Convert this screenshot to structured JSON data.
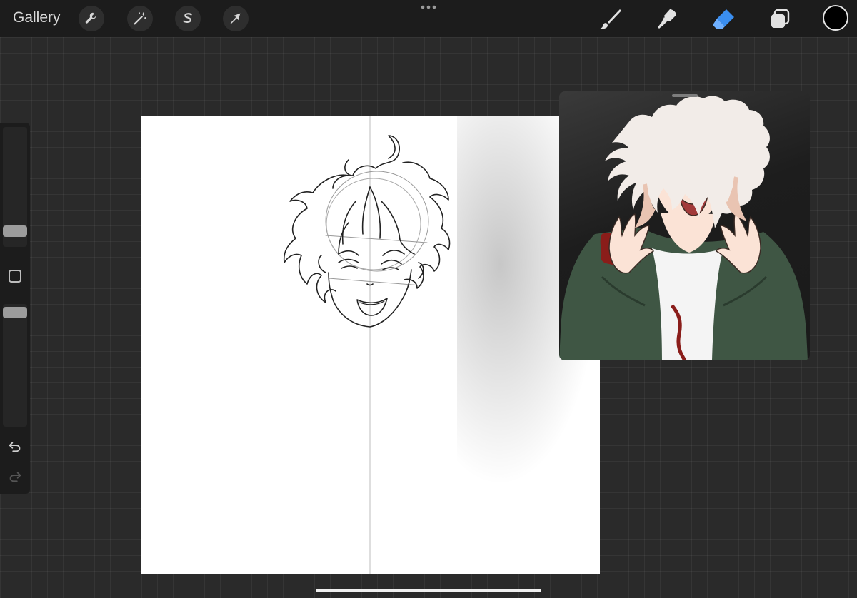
{
  "topbar": {
    "gallery_label": "Gallery",
    "left_tools": [
      {
        "name": "actions",
        "icon": "wrench-icon"
      },
      {
        "name": "adjustments",
        "icon": "magic-wand-icon"
      },
      {
        "name": "selection",
        "icon": "selection-s-icon"
      },
      {
        "name": "transform",
        "icon": "arrow-cursor-icon"
      }
    ],
    "more_icon": "ellipsis-icon",
    "right_tools": [
      {
        "name": "brush",
        "icon": "brush-icon",
        "active": false
      },
      {
        "name": "smudge",
        "icon": "smudge-icon",
        "active": false
      },
      {
        "name": "eraser",
        "icon": "eraser-icon",
        "active": true
      },
      {
        "name": "layers",
        "icon": "layers-icon",
        "active": false
      }
    ],
    "current_color": "#000000",
    "active_accent": "#3a8ef0"
  },
  "sidebar": {
    "brush_size_slider": "size-slider",
    "opacity_slider": "opacity-slider",
    "modify_button": "square-modify-icon",
    "undo_icon": "undo-icon",
    "redo_icon": "redo-icon"
  },
  "canvas": {
    "background": "#ffffff",
    "content": "pencil-sketch-of-character-head",
    "guide": "vertical-symmetry-line"
  },
  "reference": {
    "content": "reference-illustration-of-character",
    "colors": {
      "hair": "#f2ece8",
      "jacket": "#3f5644",
      "skin": "#fbe3d6",
      "blood": "#8a1d1a"
    }
  }
}
